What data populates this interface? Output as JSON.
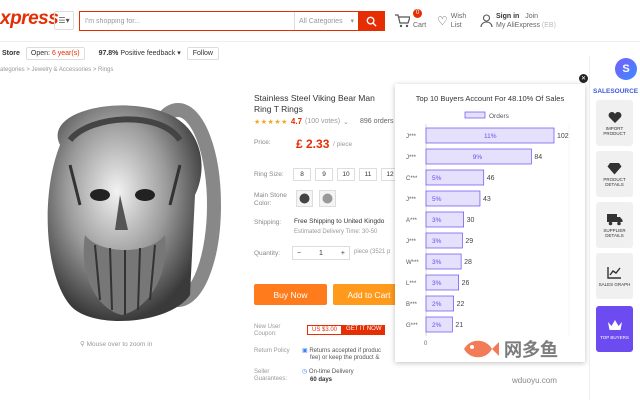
{
  "header": {
    "logo": "xpress",
    "search_placeholder": "I'm shopping for...",
    "search_category": "All Categories",
    "cart_label": "Cart",
    "cart_count": "0",
    "wish_label1": "Wish",
    "wish_label2": "List",
    "signin": "Sign in",
    "join": "Join",
    "my_account": "My AliExpress",
    "my_account_tag": "(EB)"
  },
  "store": {
    "name": "Store",
    "open_label": "Open:",
    "open_years": "6 year(s)",
    "feedback_pct": "97.8%",
    "feedback_label": "Positive feedback",
    "follow": "Follow"
  },
  "breadcrumb": "ategories > Jewelry & Accessories > Rings",
  "product": {
    "title": "Stainless Steel Viking Bear Man Ring T Rings",
    "stars": "★★★★★",
    "rating": "4.7",
    "votes": "(100 votes)",
    "orders": "896 orders",
    "price_label": "Price:",
    "price": "£ 2.33",
    "per": "/ piece",
    "size_label": "Ring Size:",
    "sizes": [
      "8",
      "9",
      "10",
      "11",
      "12"
    ],
    "color_label1": "Main Stone",
    "color_label2": "Color:",
    "shipping_label": "Shipping:",
    "shipping": "Free Shipping to United Kingdo",
    "delivery": "Estimated Delivery Time: 30-50",
    "quantity_label": "Quantity:",
    "quantity": "1",
    "quantity_avail": "piece (3521 p",
    "buy_now": "Buy Now",
    "add_to_cart": "Add to Cart",
    "zoom_hint": "Mouse over to zoom in",
    "coupon_label1": "New User",
    "coupon_label2": "Coupon:",
    "coupon_value": "US $3.00",
    "coupon_get": "GET IT NOW",
    "return_label": "Return Policy",
    "return_text1": "Returns accepted if produc",
    "return_text2": "fee) or keep the product &",
    "guarantee_label1": "Seller",
    "guarantee_label2": "Guarantees:",
    "guarantee_text1": "On-time Delivery",
    "guarantee_text2": "60 days"
  },
  "popup": {
    "title": "Top 10 Buyers Account For 48.10% Of Sales",
    "legend": "Orders"
  },
  "chart_data": {
    "type": "bar",
    "orientation": "horizontal",
    "title": "Top 10 Buyers Account For 48.10% Of Sales",
    "categories": [
      "J***",
      "J***",
      "C***",
      "J***",
      "A***",
      "J***",
      "W***",
      "L***",
      "B***",
      "G***"
    ],
    "series": [
      {
        "name": "Orders",
        "values": [
          102,
          84,
          46,
          43,
          30,
          29,
          28,
          26,
          22,
          21
        ]
      }
    ],
    "percent_labels": [
      "11%",
      "9%",
      "5%",
      "5%",
      "3%",
      "3%",
      "3%",
      "3%",
      "2%",
      "2%"
    ],
    "x_tick": "0",
    "xlim": [
      0,
      102
    ],
    "bar_color": "#e5e0fb",
    "bar_stroke": "#6c4cf0",
    "legend_position": "top"
  },
  "sidebar": {
    "brand": "SALESOURCE",
    "items": [
      {
        "label": "IMPORT PRODUCT",
        "icon": "heart-icon"
      },
      {
        "label": "PRODUCT DETAILS",
        "icon": "diamond-icon"
      },
      {
        "label": "SUPPLIER DETAILS",
        "icon": "truck-icon"
      },
      {
        "label": "SALES GRAPH",
        "icon": "chart-icon"
      },
      {
        "label": "TOP BUYERS",
        "icon": "crown-icon"
      }
    ]
  },
  "watermark": {
    "cn": "网多鱼",
    "url": "wduoyu.com"
  },
  "colors": {
    "accent": "#e62e04",
    "buy": "#ff7b1c",
    "cart": "#ff9a1c",
    "purple": "#6c4cf0"
  }
}
